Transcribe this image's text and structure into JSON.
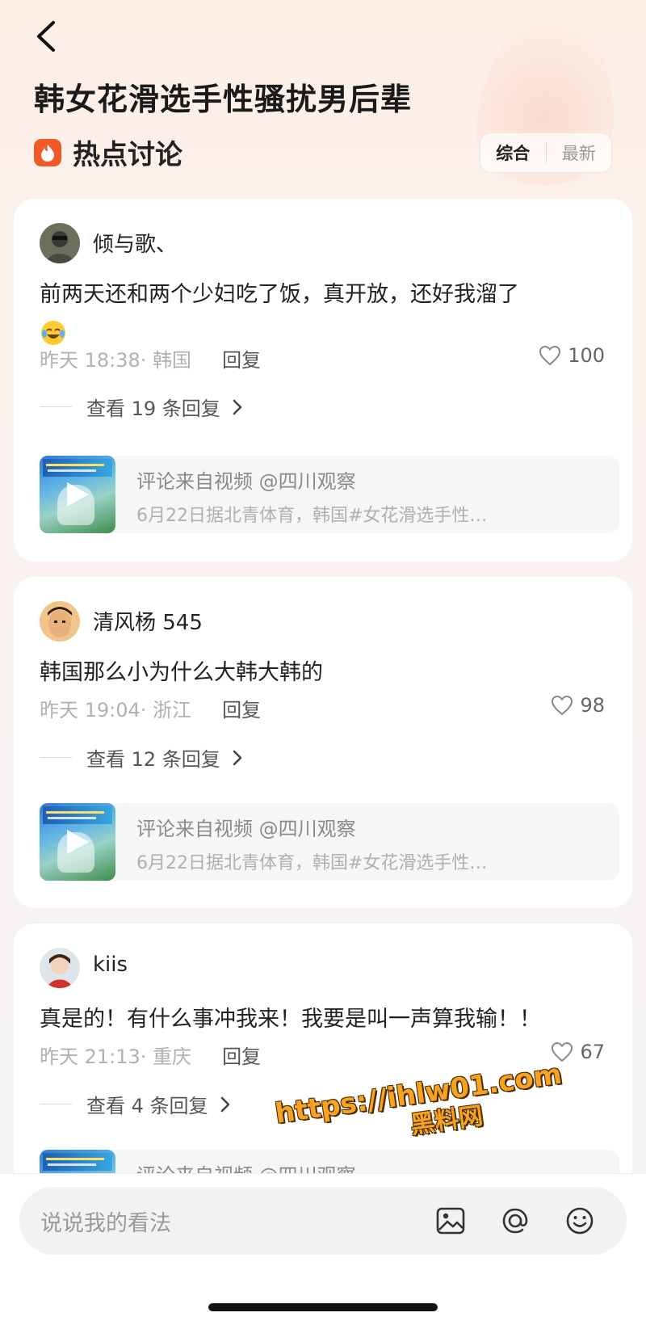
{
  "header": {
    "back_icon": "chevron-left-icon",
    "title": "韩女花滑选手性骚扰男后辈",
    "section_icon": "fire-icon",
    "section_label": "热点讨论",
    "sort_options": [
      "综合",
      "最新"
    ],
    "sort_selected": "综合"
  },
  "comments": [
    {
      "user": "倾与歌、",
      "text": "前两天还和两个少妇吃了饭，真开放，还好我溜了",
      "emoji": "tears-of-joy-icon",
      "time": "昨天 18:38",
      "location": "· 韩国",
      "reply_label": "回复",
      "likes": "100",
      "view_replies": "查看 19 条回复",
      "source_line1": "评论来自视频 @四川观察",
      "source_line2": "6月22日据北青体育，韩国#女花滑选手性…"
    },
    {
      "user": "清风杨 545",
      "text": "韩国那么小为什么大韩大韩的",
      "time": "昨天 19:04",
      "location": "· 浙江",
      "reply_label": "回复",
      "likes": "98",
      "view_replies": "查看 12 条回复",
      "source_line1": "评论来自视频 @四川观察",
      "source_line2": "6月22日据北青体育，韩国#女花滑选手性…"
    },
    {
      "user": "kiis",
      "text": "真是的！有什么事冲我来！我要是叫一声算我输！！",
      "time": "昨天 21:13",
      "location": "· 重庆",
      "reply_label": "回复",
      "likes": "67",
      "view_replies": "查看 4 条回复",
      "source_line1": "评论来自视频 @四川观察"
    }
  ],
  "watermark": {
    "url": "https://ihlw01.com",
    "name": "黑料网"
  },
  "bottom_bar": {
    "input_placeholder": "说说我的看法",
    "icons": [
      "image-icon",
      "at-icon",
      "emoji-icon"
    ]
  },
  "colors": {
    "accent_orange": "#f05a28",
    "background": "#fbf2ee",
    "watermark": "#f7a322"
  }
}
